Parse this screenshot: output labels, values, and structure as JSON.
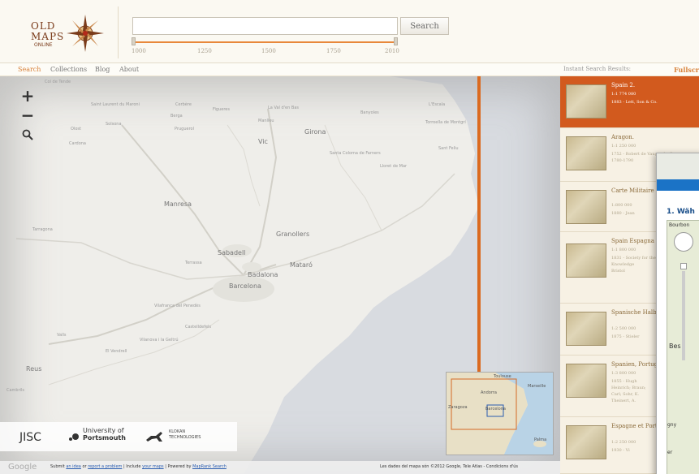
{
  "logo": {
    "line1": "OLD",
    "line2": "MAPS",
    "line3": "ONLINE"
  },
  "search": {
    "button_label": "Search",
    "value": ""
  },
  "timeline": {
    "ticks": [
      "1000",
      "1250",
      "1500",
      "1750",
      "2010"
    ]
  },
  "nav": {
    "items": [
      "Search",
      "Collections",
      "Blog",
      "About"
    ],
    "instant_label": "Instant Search Results:",
    "fullscreen": "Fullscr"
  },
  "map": {
    "labels": [
      "Col de Tende",
      "Saint Laurent du Maroni",
      "Cerbère",
      "Figueres",
      "La Val d'en Bas",
      "Banyoles",
      "L'Escala",
      "Olost",
      "Berga",
      "Girona",
      "Torroella de Montgrí",
      "Solsona",
      "Pruguerol",
      "Manlleu",
      "Sant Feliu",
      "Cardona",
      "Vic",
      "Santa Coloma de Farners",
      "Lloret de Mar",
      "Manresa",
      "Granollers",
      "Mataró",
      "Sabadell",
      "Terrassa",
      "Badalona",
      "Barcelona",
      "Vilafranca del Penedès",
      "Castelldefels",
      "Vilanova i la Geltrú",
      "Valls",
      "El Vendrell",
      "Tarragona",
      "Reus",
      "Cambrils"
    ],
    "cities": [
      "Sabadell",
      "Barcelona",
      "Badalona",
      "Mataró",
      "Granollers",
      "Manresa",
      "Vic",
      "Girona"
    ],
    "logos": {
      "jisc": "JISC",
      "portsmouth_1": "University of",
      "portsmouth_2": "Portsmouth",
      "klokan_1": "KLOKAN",
      "klokan_2": "TECHNOLOGIES"
    },
    "footer": {
      "google": "Google",
      "text_1": "Submit",
      "link_1": "an idea",
      "text_2": "or",
      "link_2": "report a problem",
      "text_3": "| Include",
      "link_3": "your maps",
      "text_4": "| Powered by",
      "link_4": "MapRank Search"
    },
    "attribution": "Les dades del mapa són ©2012 Google, Tele Atlas - Condicions d'ús",
    "overview": {
      "labels": [
        "Toulouse",
        "Andorra",
        "Marseille",
        "Zaragoza",
        "Barcelona",
        "Palma"
      ]
    }
  },
  "results": [
    {
      "title": "Spain 2.",
      "scale": "1:1 774 080",
      "meta": "1883 - Lett, Son & Co."
    },
    {
      "title": "Aragon.",
      "scale": "1:1 250 000",
      "meta": "1752 - Robert de Vaugondy, G.\n1780-1790"
    },
    {
      "title": "Carte Militaire des Pyrénées.",
      "scale": "1:800 000",
      "meta": "1880 - Jean"
    },
    {
      "title": "Spain Espagna",
      "scale": "1:1 800 000",
      "meta": "1831 - Society for the Diffusion of Useful Knowledge\nBristol"
    },
    {
      "title": "Spanische Halbinsel Blatt 2.",
      "scale": "1:2 500 000",
      "meta": "1875 - Stieler"
    },
    {
      "title": "Spanien, Portugal",
      "scale": "1:3 800 000",
      "meta": "1855 - Hugh\nHeinrich; Braun;\nCarl; Sohr, K.\nTheinert, A."
    },
    {
      "title": "Espagne et Portugal Flle. N.E.",
      "scale": "1:2 250 000",
      "meta": "1930 - Vi"
    }
  ],
  "popup": {
    "step": "1. Wäh",
    "labels": [
      "Bourbon",
      "Bes",
      "gny",
      "er"
    ]
  }
}
